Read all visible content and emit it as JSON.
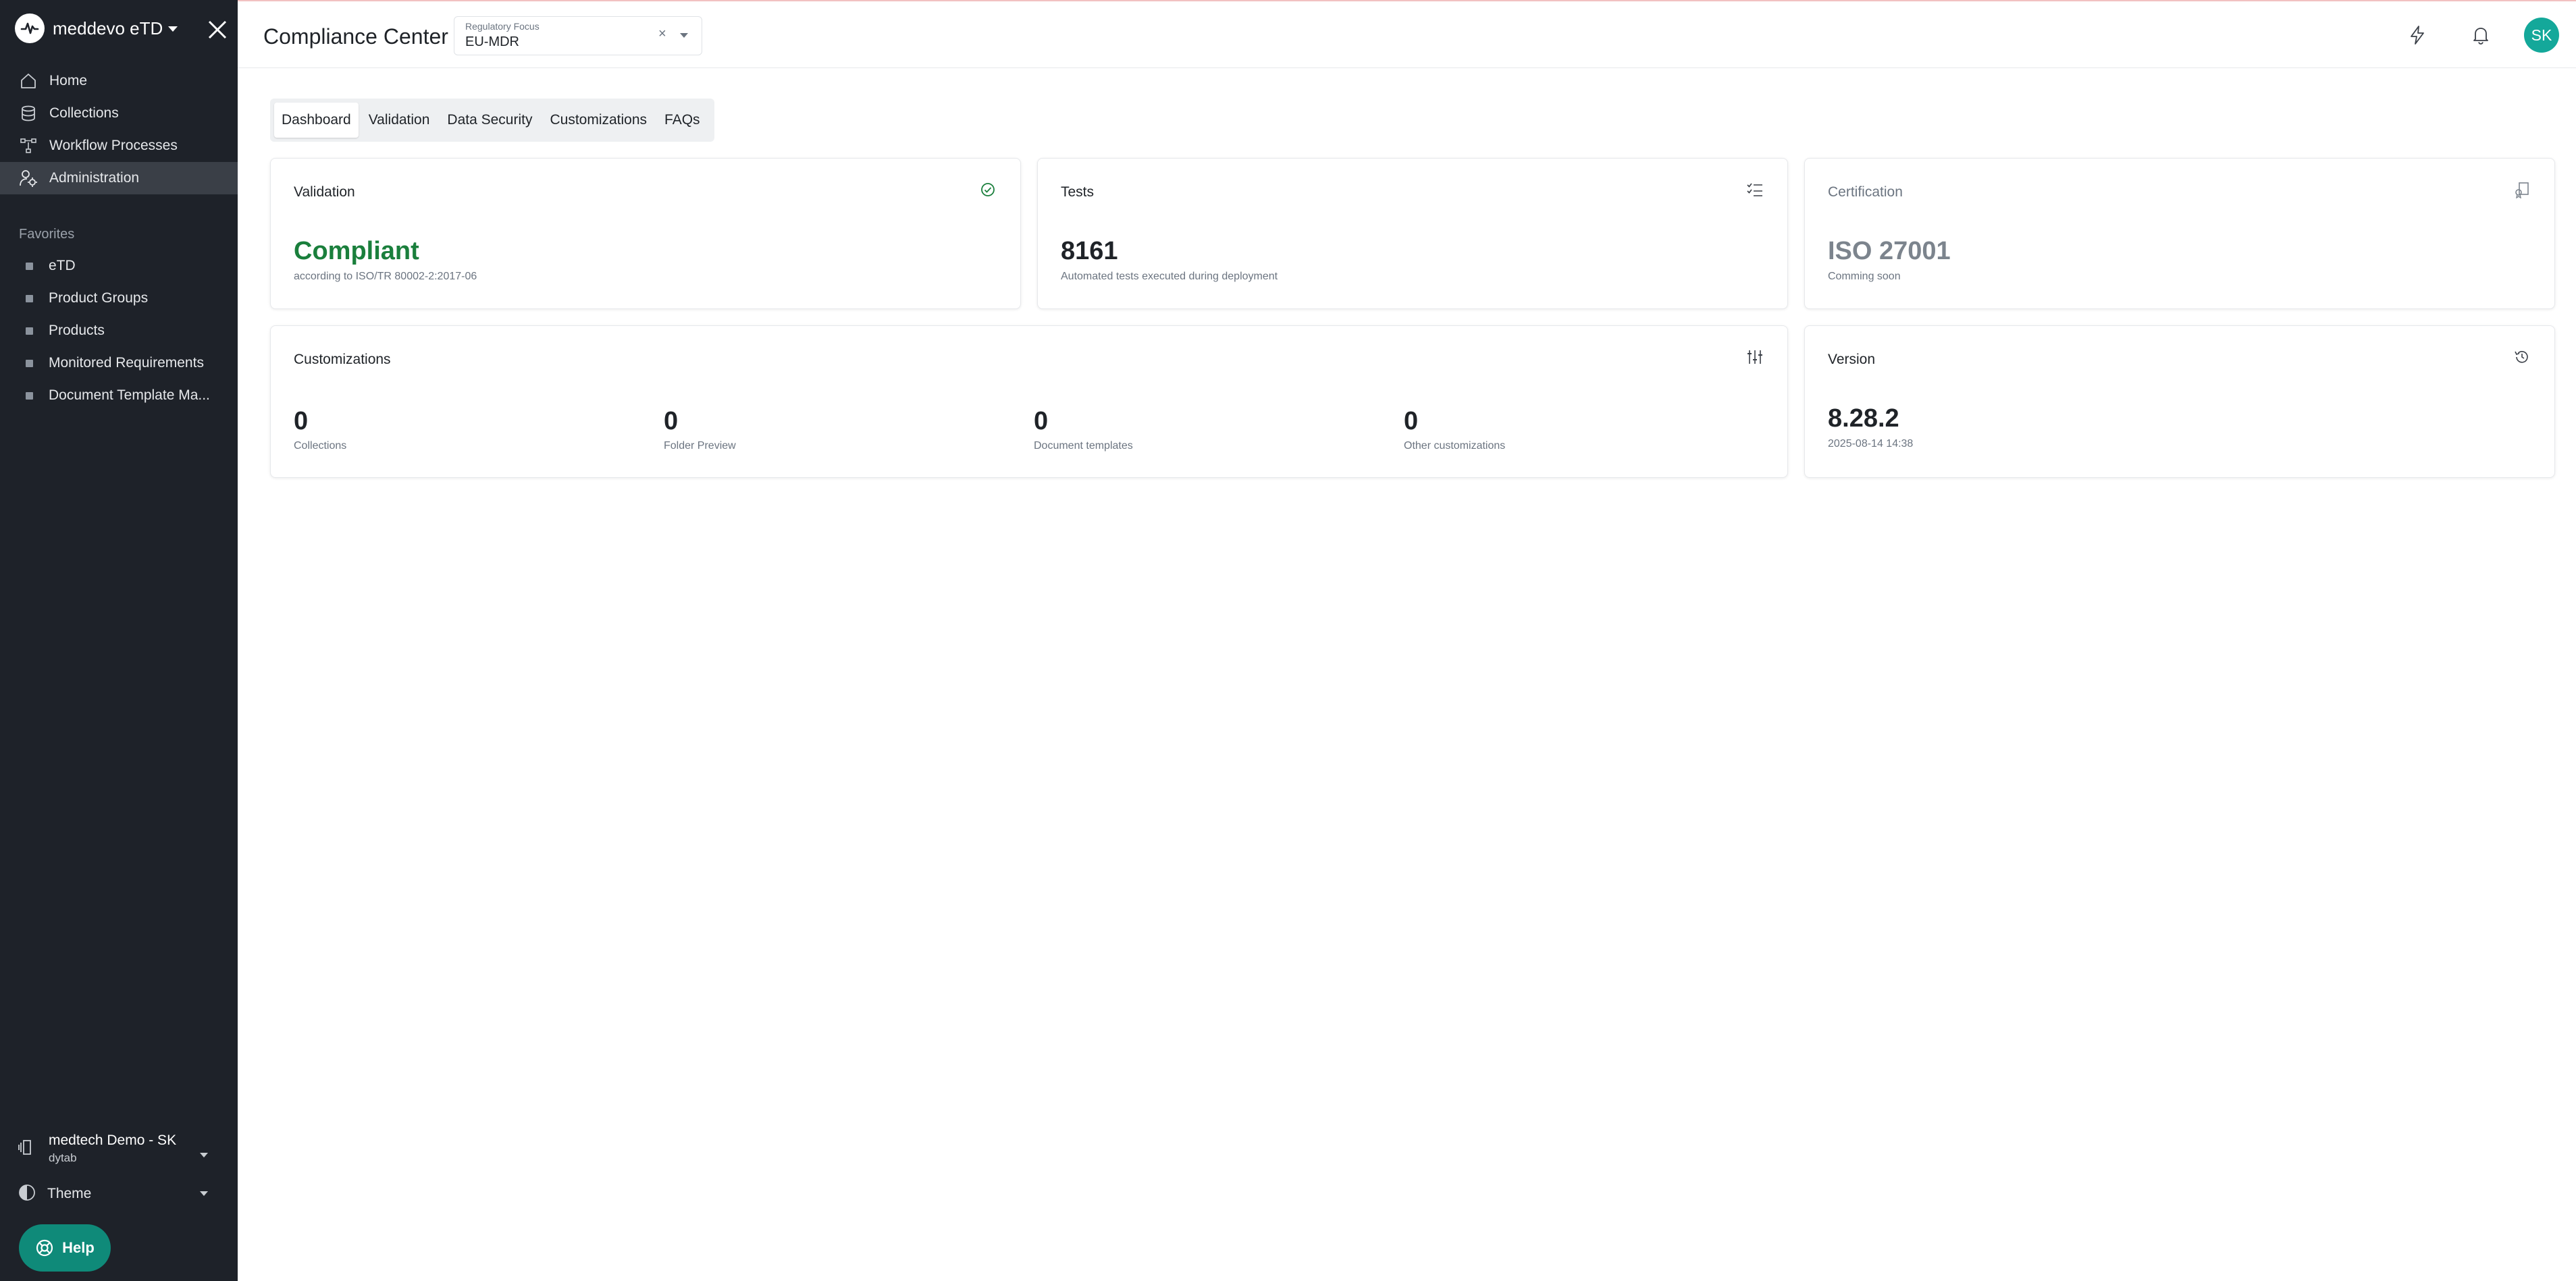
{
  "app": {
    "brand": "meddevo eTD",
    "page_title": "Compliance Center"
  },
  "sidebar": {
    "nav": [
      {
        "label": "Home",
        "icon": "home-icon"
      },
      {
        "label": "Collections",
        "icon": "database-icon"
      },
      {
        "label": "Workflow Processes",
        "icon": "workflow-icon"
      },
      {
        "label": "Administration",
        "icon": "user-gear-icon",
        "active": true
      }
    ],
    "favorites_title": "Favorites",
    "favorites": [
      {
        "label": "eTD"
      },
      {
        "label": "Product Groups"
      },
      {
        "label": "Products"
      },
      {
        "label": "Monitored Requirements"
      },
      {
        "label": "Document Template Ma..."
      }
    ],
    "workspace": {
      "name": "medtech Demo - SK",
      "sub": "dytab"
    },
    "theme_label": "Theme",
    "help_label": "Help"
  },
  "regulatory_focus": {
    "label": "Regulatory Focus",
    "value": "EU-MDR"
  },
  "user": {
    "initials": "SK"
  },
  "tabs": [
    {
      "label": "Dashboard",
      "active": true
    },
    {
      "label": "Validation"
    },
    {
      "label": "Data Security"
    },
    {
      "label": "Customizations"
    },
    {
      "label": "FAQs"
    }
  ],
  "cards": {
    "validation": {
      "title": "Validation",
      "value": "Compliant",
      "sub": "according to ISO/TR 80002-2:2017-06"
    },
    "tests": {
      "title": "Tests",
      "value": "8161",
      "sub": "Automated tests executed during deployment"
    },
    "certification": {
      "title": "Certification",
      "value": "ISO 27001",
      "sub": "Comming soon"
    },
    "customizations": {
      "title": "Customizations",
      "metrics": [
        {
          "value": "0",
          "label": "Collections"
        },
        {
          "value": "0",
          "label": "Folder Preview"
        },
        {
          "value": "0",
          "label": "Document templates"
        },
        {
          "value": "0",
          "label": "Other customizations"
        }
      ]
    },
    "version": {
      "title": "Version",
      "value": "8.28.2",
      "sub": "2025-08-14 14:38"
    }
  },
  "colors": {
    "accent": "#14a89a",
    "help": "#0f8a79",
    "compliant": "#1a7f3c",
    "sidebar": "#1e2229"
  }
}
